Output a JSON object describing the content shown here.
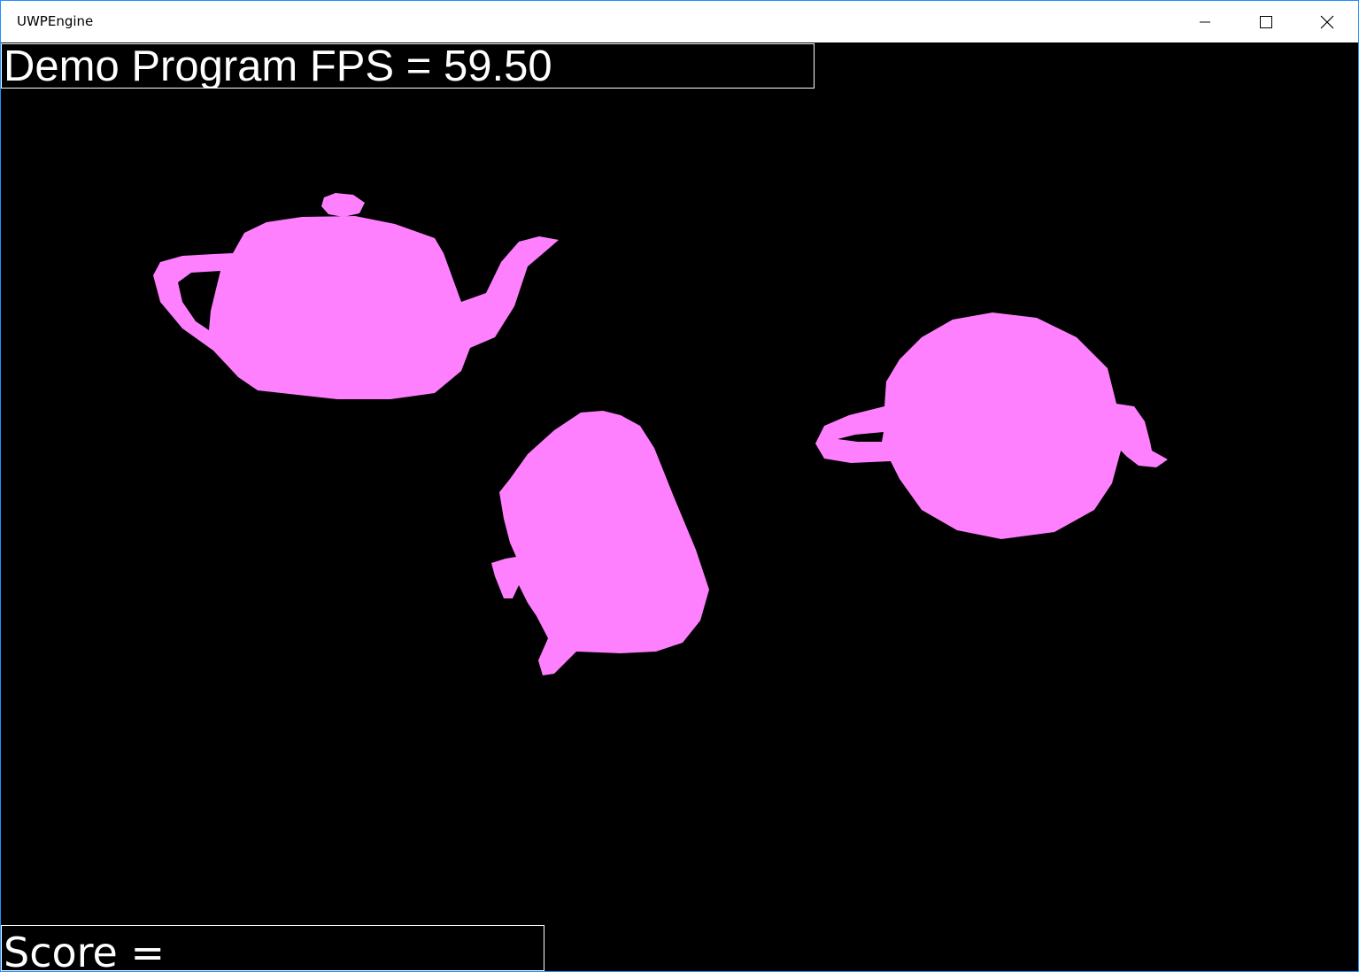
{
  "window": {
    "title": "UWPEngine",
    "controls": {
      "minimize": "minimize-icon",
      "maximize": "maximize-icon",
      "close": "close-icon"
    }
  },
  "hud": {
    "fps_text": "Demo Program FPS = 59.50",
    "score_text": "Score = "
  },
  "scene": {
    "background_color": "#000000",
    "object_color": "#ff80ff",
    "objects": [
      "teapot",
      "teapot",
      "teapot"
    ]
  }
}
